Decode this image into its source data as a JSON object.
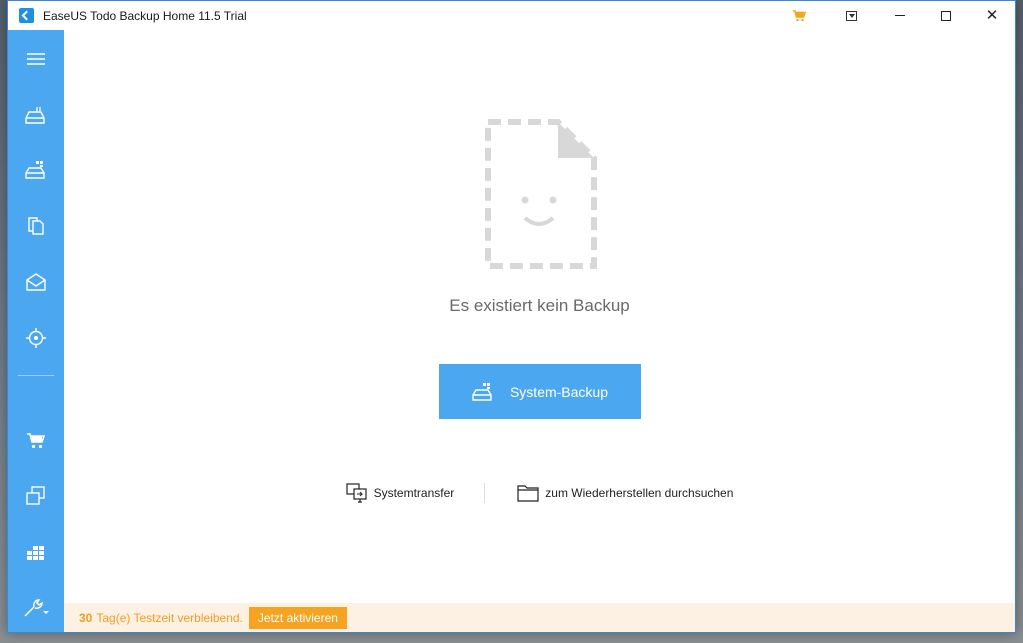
{
  "window": {
    "title": "EaseUS Todo Backup Home 11.5 Trial",
    "controls": [
      "cart-icon",
      "dropdown-icon",
      "minimize",
      "maximize",
      "close"
    ]
  },
  "sidebar": {
    "items": [
      {
        "icon": "menu-icon"
      },
      {
        "icon": "disk-backup-icon"
      },
      {
        "icon": "system-backup-icon"
      },
      {
        "icon": "file-backup-icon"
      },
      {
        "icon": "mail-backup-icon"
      },
      {
        "icon": "smart-backup-icon"
      },
      {
        "icon": "cart-icon"
      },
      {
        "icon": "clone-icon"
      },
      {
        "icon": "windows-tools-icon"
      },
      {
        "icon": "tools-icon"
      }
    ],
    "accent": "#4ba7f0"
  },
  "main": {
    "empty_message": "Es existiert kein Backup",
    "primary_button": "System-Backup",
    "links": {
      "system_transfer": "Systemtransfer",
      "browse_restore": "zum Wiederherstellen durchsuchen"
    }
  },
  "footer": {
    "days": "30",
    "trial_text": "Tag(e) Testzeit verbleibend.",
    "activate_label": "Jetzt aktivieren",
    "accent": "#f6a322"
  }
}
